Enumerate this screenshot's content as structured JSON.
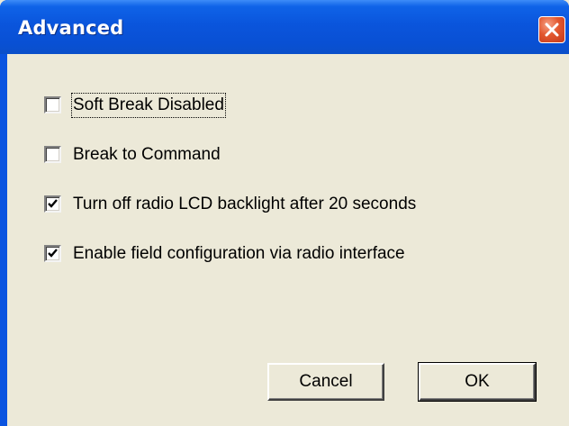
{
  "window": {
    "title": "Advanced",
    "close_icon": "close-icon"
  },
  "options": [
    {
      "label": "Soft Break Disabled",
      "checked": false
    },
    {
      "label": "Break to Command",
      "checked": false
    },
    {
      "label": "Turn off radio LCD backlight after 20 seconds",
      "checked": true
    },
    {
      "label": "Enable field configuration via radio interface",
      "checked": true
    }
  ],
  "buttons": {
    "cancel_label": "Cancel",
    "ok_label": "OK"
  },
  "colors": {
    "titlebar": "#0a55dc",
    "close_button": "#e2572f",
    "dialog_background": "#ece9d8"
  }
}
